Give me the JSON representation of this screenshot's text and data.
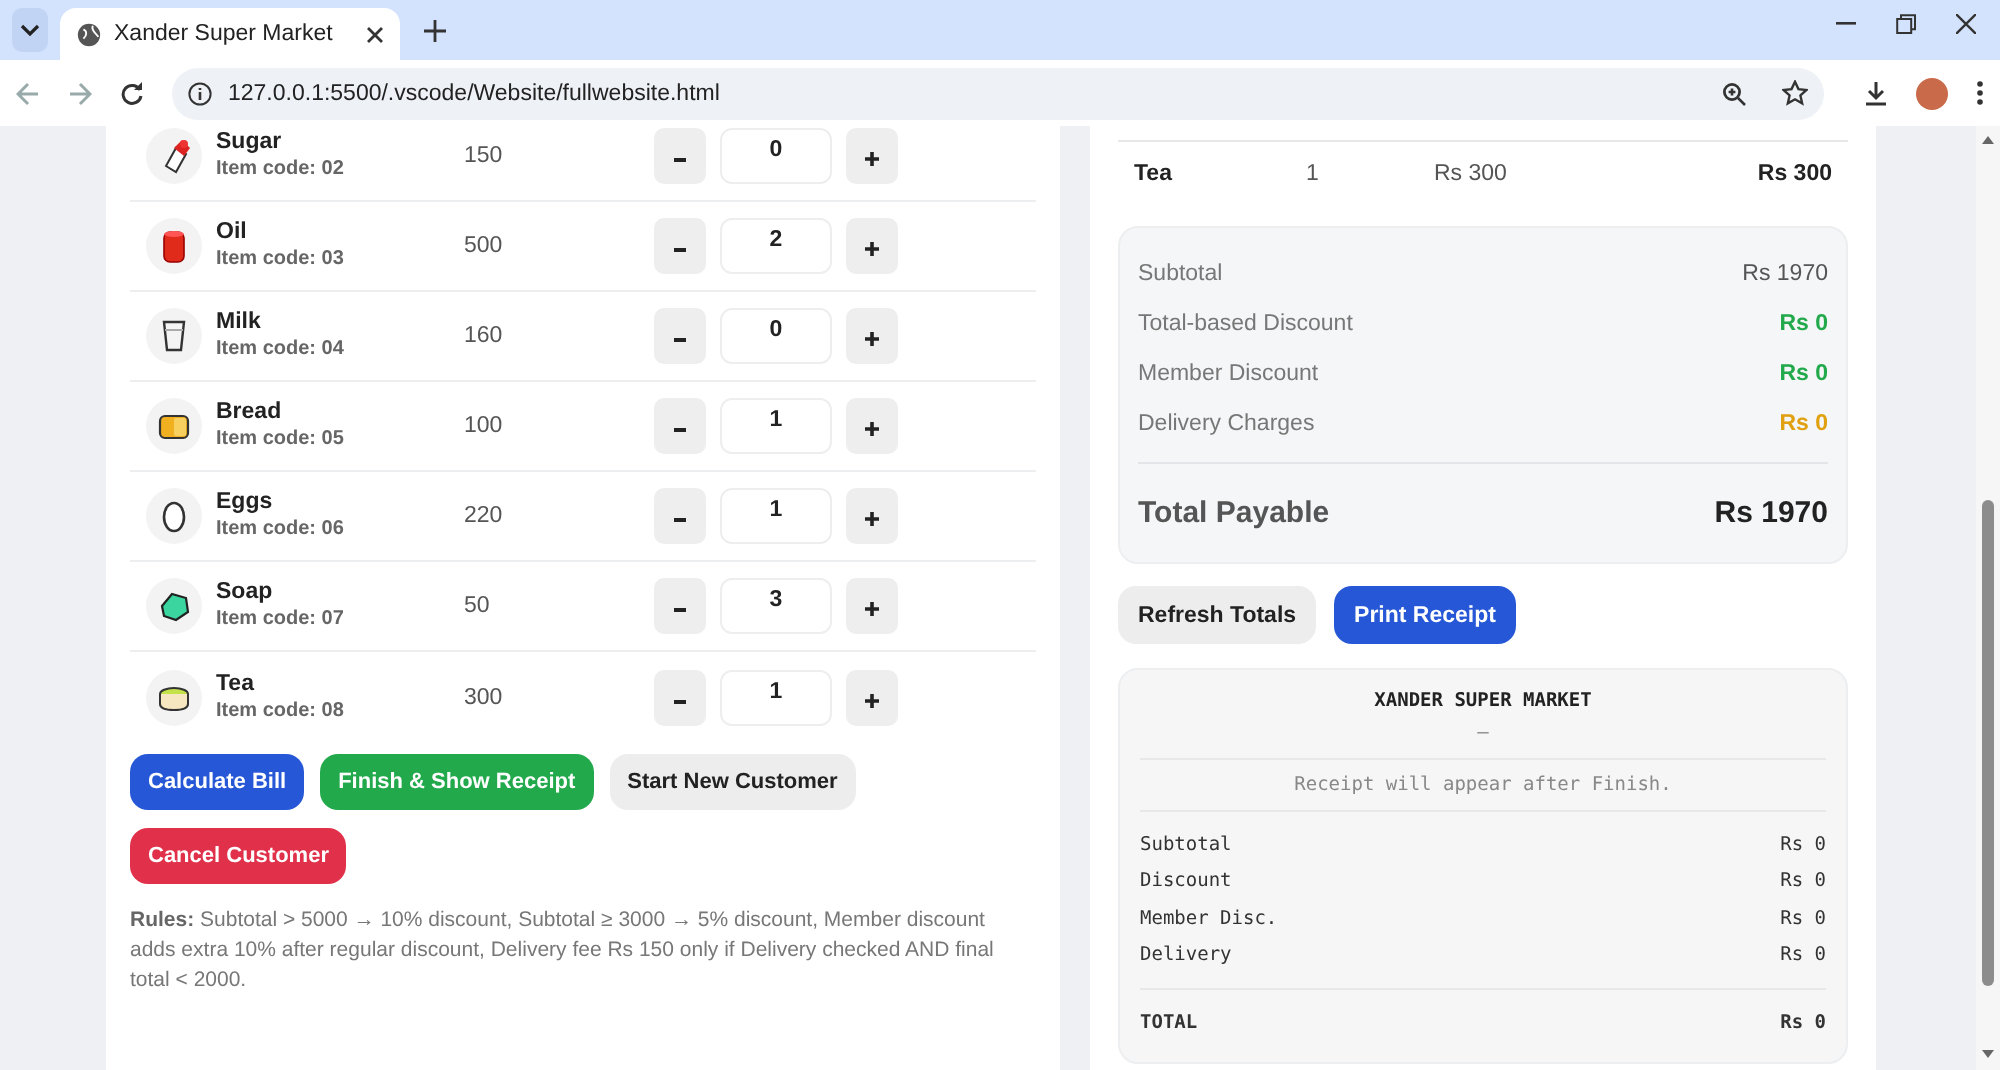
{
  "browser": {
    "tab_title": "Xander Super Market",
    "url": "127.0.0.1:5500/.vscode/Website/fullwebsite.html"
  },
  "products": [
    {
      "name": "Sugar",
      "code": "Item code: 02",
      "price": "150",
      "qty": "0"
    },
    {
      "name": "Oil",
      "code": "Item code: 03",
      "price": "500",
      "qty": "2"
    },
    {
      "name": "Milk",
      "code": "Item code: 04",
      "price": "160",
      "qty": "0"
    },
    {
      "name": "Bread",
      "code": "Item code: 05",
      "price": "100",
      "qty": "1"
    },
    {
      "name": "Eggs",
      "code": "Item code: 06",
      "price": "220",
      "qty": "1"
    },
    {
      "name": "Soap",
      "code": "Item code: 07",
      "price": "50",
      "qty": "3"
    },
    {
      "name": "Tea",
      "code": "Item code: 08",
      "price": "300",
      "qty": "1"
    }
  ],
  "actions": [
    {
      "label": "Calculate Bill",
      "kind": "primary"
    },
    {
      "label": "Finish & Show Receipt",
      "kind": "success"
    },
    {
      "label": "Start New Customer",
      "kind": "secondary"
    },
    {
      "label": "Cancel Customer",
      "kind": "danger"
    }
  ],
  "rules": "**Rules:** Subtotal > 5000 → 10% discount, Subtotal ≥ 3000 → 5% discount, Member discount adds extra 10% after regular discount, Delivery fee Rs 150 only if Delivery checked AND final total < 2000.",
  "bill_line": {
    "name": "Tea",
    "qty": "1",
    "price": "Rs 300",
    "total": "Rs 300"
  },
  "totals": [
    {
      "label": "Subtotal",
      "value": "Rs 1970",
      "color": "#555555"
    },
    {
      "label": "Total-based Discount",
      "value": "Rs 0",
      "color": "#22a94b"
    },
    {
      "label": "Member Discount",
      "value": "Rs 0",
      "color": "#22a94b"
    },
    {
      "label": "Delivery Charges",
      "value": "Rs 0",
      "color": "#e0a010"
    }
  ],
  "total_payable": {
    "label": "Total Payable",
    "value": "Rs 1970"
  },
  "total_buttons": [
    {
      "label": "Refresh Totals",
      "kind": "secondary"
    },
    {
      "label": "Print Receipt",
      "kind": "primary"
    }
  ],
  "receipt": {
    "title": "XANDER SUPER MARKET",
    "subtitle": "–",
    "message": "Receipt will appear after Finish.",
    "lines": [
      {
        "label": "Subtotal",
        "value": "Rs 0"
      },
      {
        "label": "Discount",
        "value": "Rs 0"
      },
      {
        "label": "Member Disc.",
        "value": "Rs 0"
      },
      {
        "label": "Delivery",
        "value": "Rs 0"
      }
    ],
    "total": {
      "label": "TOTAL",
      "value": "Rs 0"
    }
  }
}
